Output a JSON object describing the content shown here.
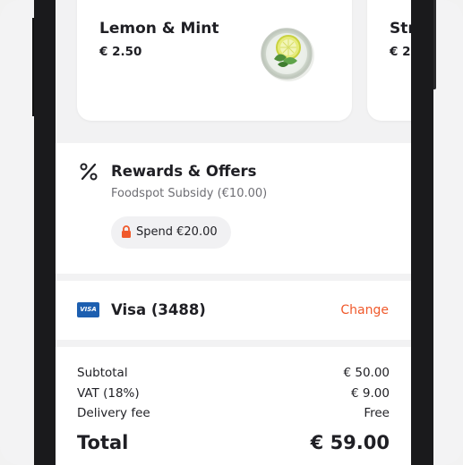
{
  "products": [
    {
      "name": "Lemon & Mint",
      "price": "€ 2.50"
    },
    {
      "name": "Str",
      "price": "€ 2."
    }
  ],
  "rewards": {
    "title": "Rewards & Offers",
    "subtitle": "Foodspot Subsidy (€10.00)",
    "spend_label": "Spend €20.00"
  },
  "payment": {
    "card_brand": "VISA",
    "label": "Visa (3488)",
    "change_label": "Change"
  },
  "summary": {
    "rows": [
      {
        "label": "Subtotal",
        "value": "€ 50.00"
      },
      {
        "label": "VAT (18%)",
        "value": "€ 9.00"
      },
      {
        "label": "Delivery fee",
        "value": "Free"
      }
    ],
    "total": {
      "label": "Total",
      "value": "€ 59.00"
    }
  },
  "colors": {
    "accent": "#f0592b",
    "visa_blue": "#1d5fb0",
    "phone_body": "#1a1a1c"
  },
  "icons": {
    "rewards": "percent-icon",
    "spend": "lock-icon",
    "payment": "visa-card-icon"
  }
}
